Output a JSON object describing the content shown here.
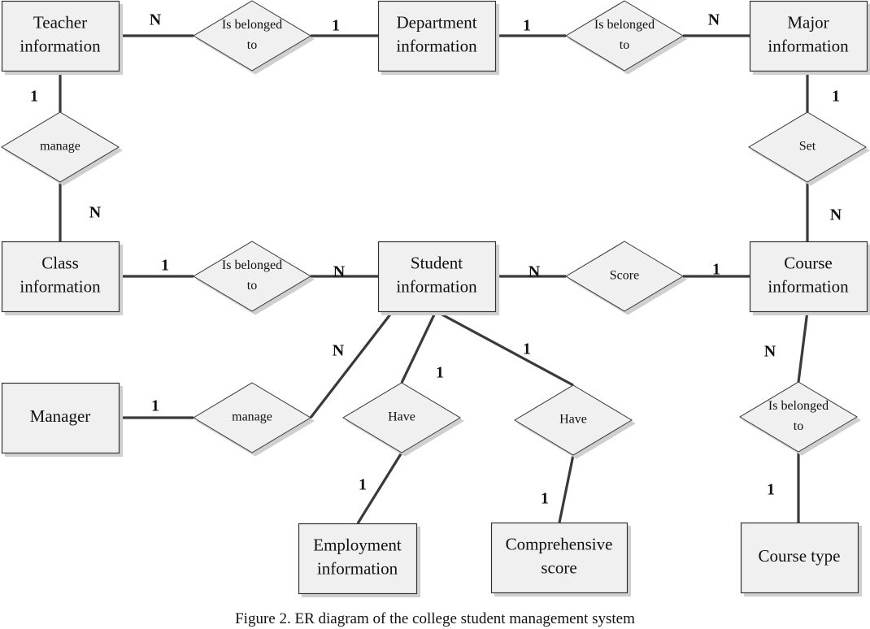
{
  "caption": "Figure 2.    ER diagram of the college student management system",
  "colors": {
    "fill": "#f0f0f0",
    "stroke": "#333333",
    "line": "#3a3a3a",
    "shadow": "#d6d6d6"
  },
  "entities": [
    {
      "id": "teacher",
      "lines": [
        "Teacher",
        "information"
      ]
    },
    {
      "id": "department",
      "lines": [
        "Department",
        "information"
      ]
    },
    {
      "id": "major",
      "lines": [
        "Major",
        "information"
      ]
    },
    {
      "id": "class",
      "lines": [
        "Class",
        "information"
      ]
    },
    {
      "id": "student",
      "lines": [
        "Student",
        "information"
      ]
    },
    {
      "id": "course",
      "lines": [
        "Course",
        "information"
      ]
    },
    {
      "id": "manager",
      "lines": [
        "Manager"
      ]
    },
    {
      "id": "employment",
      "lines": [
        "Employment",
        "information"
      ]
    },
    {
      "id": "comprehensive",
      "lines": [
        "Comprehensive",
        "score"
      ]
    },
    {
      "id": "coursetype",
      "lines": [
        "Course type"
      ]
    }
  ],
  "relationships": [
    {
      "id": "r_teacher_dept",
      "lines": [
        "Is belonged",
        "to"
      ]
    },
    {
      "id": "r_dept_major",
      "lines": [
        "Is belonged",
        "to"
      ]
    },
    {
      "id": "r_teacher_class",
      "lines": [
        "manage"
      ]
    },
    {
      "id": "r_major_course",
      "lines": [
        "Set"
      ]
    },
    {
      "id": "r_class_student",
      "lines": [
        "Is belonged",
        "to"
      ]
    },
    {
      "id": "r_student_course",
      "lines": [
        "Score"
      ]
    },
    {
      "id": "r_manager_student",
      "lines": [
        "manage"
      ]
    },
    {
      "id": "r_student_employment",
      "lines": [
        "Have"
      ]
    },
    {
      "id": "r_student_comprehensive",
      "lines": [
        "Have"
      ]
    },
    {
      "id": "r_course_type",
      "lines": [
        "Is belonged",
        "to"
      ]
    }
  ],
  "connections": [
    {
      "from": "teacher",
      "to": "r_teacher_dept",
      "cardinality": "N"
    },
    {
      "from": "r_teacher_dept",
      "to": "department",
      "cardinality": "1"
    },
    {
      "from": "department",
      "to": "r_dept_major",
      "cardinality": "1"
    },
    {
      "from": "r_dept_major",
      "to": "major",
      "cardinality": "N"
    },
    {
      "from": "teacher",
      "to": "r_teacher_class",
      "cardinality": "1"
    },
    {
      "from": "r_teacher_class",
      "to": "class",
      "cardinality": "N"
    },
    {
      "from": "major",
      "to": "r_major_course",
      "cardinality": "1"
    },
    {
      "from": "r_major_course",
      "to": "course",
      "cardinality": "N"
    },
    {
      "from": "class",
      "to": "r_class_student",
      "cardinality": "1"
    },
    {
      "from": "r_class_student",
      "to": "student",
      "cardinality": "N"
    },
    {
      "from": "student",
      "to": "r_student_course",
      "cardinality": "N"
    },
    {
      "from": "r_student_course",
      "to": "course",
      "cardinality": "1"
    },
    {
      "from": "manager",
      "to": "r_manager_student",
      "cardinality": "1"
    },
    {
      "from": "r_manager_student",
      "to": "student",
      "cardinality": "N"
    },
    {
      "from": "student",
      "to": "r_student_employment",
      "cardinality": "1"
    },
    {
      "from": "r_student_employment",
      "to": "employment",
      "cardinality": "1"
    },
    {
      "from": "student",
      "to": "r_student_comprehensive",
      "cardinality": "1"
    },
    {
      "from": "r_student_comprehensive",
      "to": "comprehensive",
      "cardinality": "1"
    },
    {
      "from": "course",
      "to": "r_course_type",
      "cardinality": "N"
    },
    {
      "from": "r_course_type",
      "to": "coursetype",
      "cardinality": "1"
    }
  ]
}
